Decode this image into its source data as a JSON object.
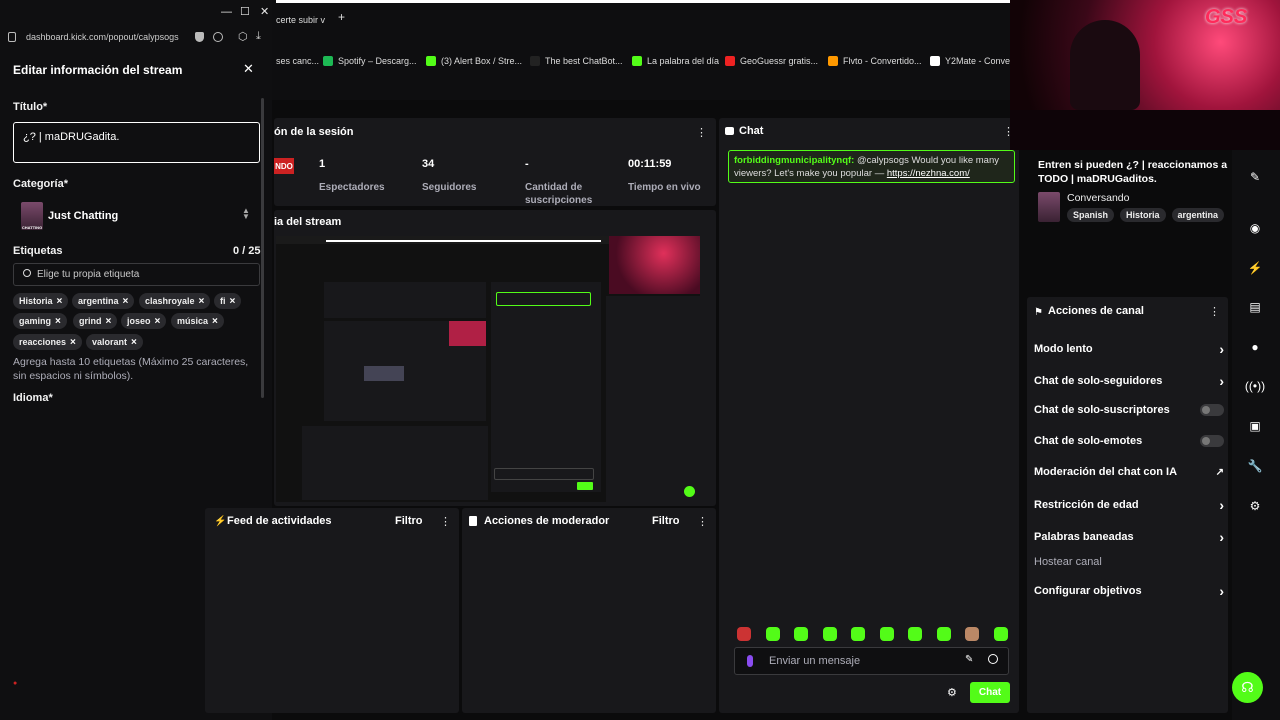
{
  "window": {
    "minimize": "—",
    "maximize": "☐",
    "close": "✕"
  },
  "browser": {
    "tab_title": "certe subir v",
    "new_tab": "+",
    "address": "dashboard.kick.com/popout/calypsogs",
    "bookmarks": [
      {
        "label": "ses canc..."
      },
      {
        "label": "Spotify – Descarg..."
      },
      {
        "label": "(3) Alert Box / Stre..."
      },
      {
        "label": "The best ChatBot..."
      },
      {
        "label": "La palabra del día"
      },
      {
        "label": "GeoGuessr gratis..."
      },
      {
        "label": "Flvto - Convertido..."
      },
      {
        "label": "Y2Mate - Convert"
      }
    ]
  },
  "edit_panel": {
    "title": "Editar información del stream",
    "close": "✕",
    "title_label": "Título*",
    "title_value": "¿? | maDRUGadita.",
    "category_label": "Categoría*",
    "category_value": "Just Chatting",
    "category_thumb_text": "CHATTING",
    "tags_label": "Etiquetas",
    "tags_count": "0 / 25",
    "tags_placeholder": "Elige tu propia etiqueta",
    "tags": [
      "Historia",
      "argentina",
      "clashroyale",
      "fi",
      "gaming",
      "grind",
      "joseo",
      "música",
      "reacciones",
      "valorant"
    ],
    "tags_hint": "Agrega hasta 10 etiquetas (Máximo 25 caracteres, sin espacios ni símbolos).",
    "language_label": "Idioma*"
  },
  "session": {
    "title": "ón de la sesión",
    "live_badge": "NDO",
    "stats": [
      {
        "value": "1",
        "label": "Espectadores"
      },
      {
        "value": "34",
        "label": "Seguidores"
      },
      {
        "value": "-",
        "label": "Cantidad de suscripciones"
      },
      {
        "value": "00:11:59",
        "label": "Tiempo en vivo"
      }
    ]
  },
  "preview": {
    "title": "ia del stream"
  },
  "activity": {
    "title": "Feed de actividades",
    "filter": "Filtro"
  },
  "modactions": {
    "title": "Acciones de moderador",
    "filter": "Filtro"
  },
  "chat": {
    "title": "Chat",
    "message": {
      "user": "forbiddingmunicipalitynqf:",
      "text": "@calypsogs Would you like many viewers? Let's make you popular — ",
      "link": "https://nezhna.com/"
    },
    "input_placeholder": "Enviar un mensaje",
    "send": "Chat"
  },
  "stream_info": {
    "title": "Entren si pueden ¿? | reaccionamos a TODO | maDRUGaditos.",
    "category": "Conversando",
    "tags": [
      "Spanish",
      "Historia",
      "argentina"
    ]
  },
  "channel_actions": {
    "title": "Acciones de canal",
    "items": [
      {
        "label": "Modo lento",
        "control": "chevron"
      },
      {
        "label": "Chat de solo-seguidores",
        "control": "chevron"
      },
      {
        "label": "Chat de solo-suscriptores",
        "control": "toggle"
      },
      {
        "label": "Chat de solo-emotes",
        "control": "toggle"
      },
      {
        "label": "Moderación del chat con IA",
        "control": "external"
      },
      {
        "label": "Restricción de edad",
        "control": "chevron"
      },
      {
        "label": "Palabras baneadas",
        "control": "chevron"
      },
      {
        "label": "Hostear canal",
        "control": "none"
      },
      {
        "label": "Configurar objetivos",
        "control": "chevron"
      }
    ]
  },
  "webcam": {
    "logo": "GSS"
  },
  "colors": {
    "accent": "#53fc18",
    "bg": "#0b0b0c",
    "card": "#18181b"
  }
}
